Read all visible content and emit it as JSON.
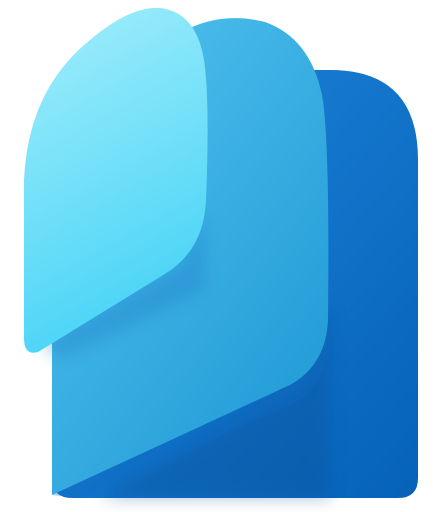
{
  "logo": {
    "icon": "stacked-pages-logo-icon",
    "colors": {
      "back_layer_light": "#1f86db",
      "back_layer_dark": "#0562b8",
      "middle_layer_light": "#52c3ef",
      "middle_layer_dark": "#1e97d4",
      "front_layer_light": "#9cecfb",
      "front_layer_dark": "#42d2f6"
    }
  }
}
